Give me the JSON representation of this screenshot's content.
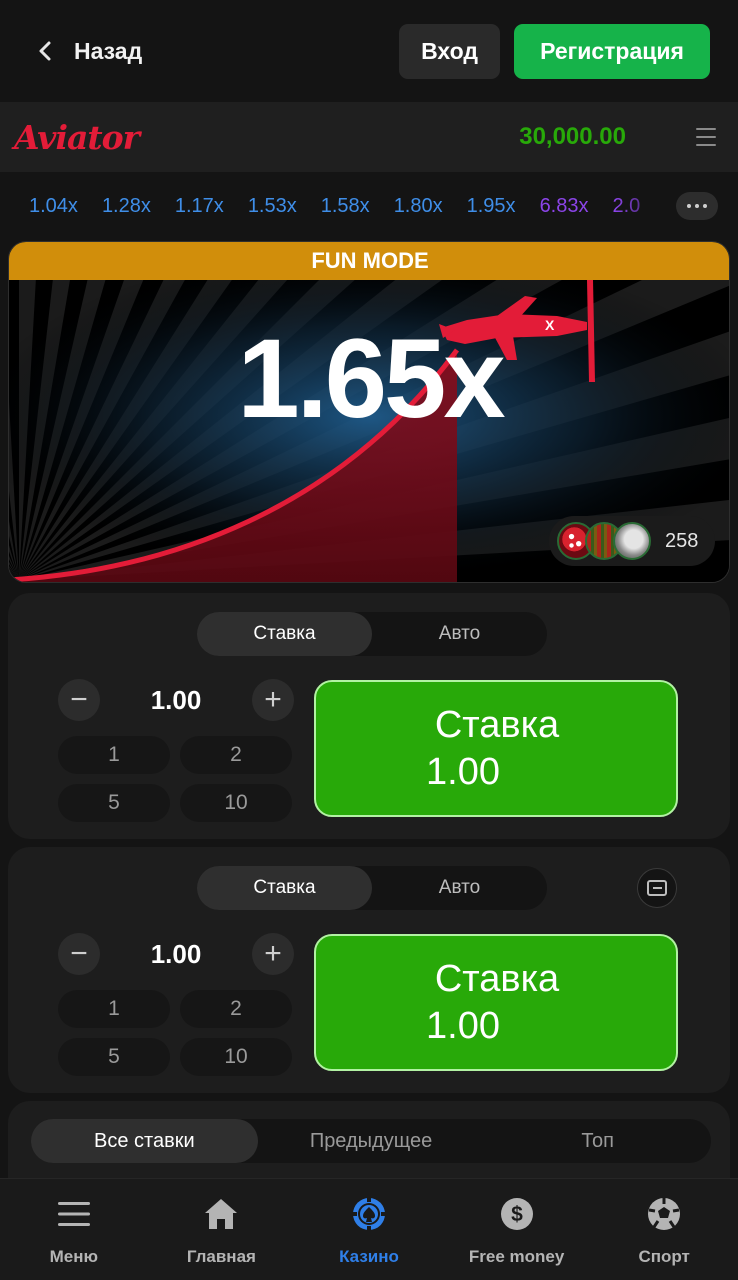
{
  "topbar": {
    "back_label": "Назад",
    "login_label": "Вход",
    "register_label": "Регистрация"
  },
  "game_header": {
    "logo": "Aviator",
    "balance": "30,000.00"
  },
  "history": [
    {
      "value": "1.04x",
      "color": "#3f8ee8"
    },
    {
      "value": "1.28x",
      "color": "#3f8ee8"
    },
    {
      "value": "1.17x",
      "color": "#3f8ee8"
    },
    {
      "value": "1.53x",
      "color": "#3f8ee8"
    },
    {
      "value": "1.58x",
      "color": "#3f8ee8"
    },
    {
      "value": "1.80x",
      "color": "#3f8ee8"
    },
    {
      "value": "1.95x",
      "color": "#3f8ee8"
    },
    {
      "value": "6.83x",
      "color": "#8b44e8"
    },
    {
      "value": "2.0",
      "color": "#8b44e8"
    }
  ],
  "game": {
    "mode_banner": "FUN MODE",
    "multiplier": "1.65x",
    "players_count": "258"
  },
  "bet_panels": [
    {
      "tabs": [
        "Ставка",
        "Авто"
      ],
      "amount": "1.00",
      "quick": [
        "1",
        "2",
        "5",
        "10"
      ],
      "bet_label": "Ставка",
      "bet_amount": "1.00"
    },
    {
      "tabs": [
        "Ставка",
        "Авто"
      ],
      "amount": "1.00",
      "quick": [
        "1",
        "2",
        "5",
        "10"
      ],
      "bet_label": "Ставка",
      "bet_amount": "1.00"
    }
  ],
  "bets_list": {
    "tabs": [
      "Все ставки",
      "Предыдущее",
      "Топ"
    ]
  },
  "bottom_nav": [
    {
      "label": "Меню",
      "icon": "menu-icon"
    },
    {
      "label": "Главная",
      "icon": "home-icon"
    },
    {
      "label": "Казино",
      "icon": "casino-chip-icon"
    },
    {
      "label": "Free money",
      "icon": "dollar-coin-icon"
    },
    {
      "label": "Спорт",
      "icon": "soccer-ball-icon"
    }
  ],
  "colors": {
    "accent_green": "#28a909",
    "register_green": "#16b34a",
    "nav_active": "#2f7fe8",
    "fun_mode": "#d18e0b",
    "aviator_red": "#e31c38"
  }
}
